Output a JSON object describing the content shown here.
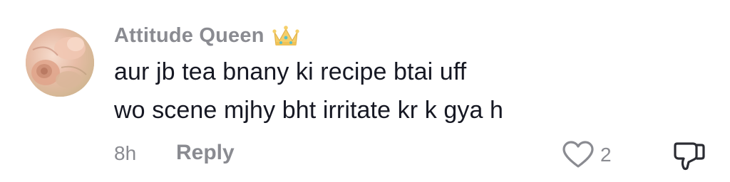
{
  "comment": {
    "username": "Attitude Queen",
    "badge_icon": "crown-emoji-icon",
    "text_lines": [
      "aur jb tea bnany ki recipe btai uff",
      "wo scene mjhy bht irritate kr k gya h"
    ],
    "timestamp": "8h",
    "reply_label": "Reply",
    "like_icon": "heart-outline-icon",
    "like_count": "2",
    "dislike_icon": "thumbs-down-icon"
  },
  "colors": {
    "primary_text": "#161823",
    "secondary_text": "#8a8b91",
    "background": "#ffffff"
  }
}
